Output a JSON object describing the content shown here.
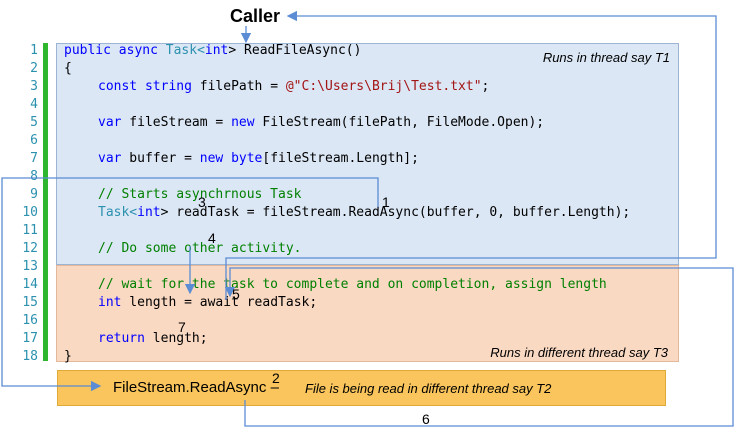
{
  "caller": "Caller",
  "notes": {
    "t1": "Runs in thread say T1",
    "t3": "Runs in different thread say T3",
    "t2": "File is being read in different thread say T2"
  },
  "readasync_label": "FileStream.ReadAsync",
  "readasync_dash": "–",
  "line_numbers": [
    "1",
    "2",
    "3",
    "4",
    "5",
    "6",
    "7",
    "8",
    "9",
    "10",
    "11",
    "12",
    "13",
    "14",
    "15",
    "16",
    "17",
    "18"
  ],
  "code": {
    "l1": [
      "public",
      "async",
      "Task<",
      "int",
      "> ReadFileAsync()"
    ],
    "l2": "{",
    "l3": [
      "const",
      "string",
      "filePath = ",
      "@\"C:\\Users\\Brij\\Test.txt\"",
      ";"
    ],
    "l5": [
      "var",
      " fileStream = ",
      "new",
      " FileStream(filePath, FileMode.Open);"
    ],
    "l7": [
      "var",
      " buffer = ",
      "new",
      "byte",
      "[fileStream.Length];"
    ],
    "l9": "// Starts asynchrnous Task",
    "l10": [
      "Task<",
      "int",
      "> readTask = fileStream.ReadAsync(buffer, 0, buffer.Length);"
    ],
    "l12": "// Do some other activity.",
    "l14": "// wait for the task to complete and on completion, assign length",
    "l15": [
      "int",
      " length = ",
      "await",
      " readTask;"
    ],
    "l17": [
      "return",
      " length;"
    ],
    "l18": "}"
  },
  "step_numbers": [
    "1",
    "2",
    "3",
    "4",
    "5",
    "6",
    "7"
  ],
  "colors": {
    "thread_t1": "#dbe7f5",
    "thread_t3": "#fad9c3",
    "thread_t2": "#f9c55c",
    "arrows": "#5b8cd4"
  }
}
